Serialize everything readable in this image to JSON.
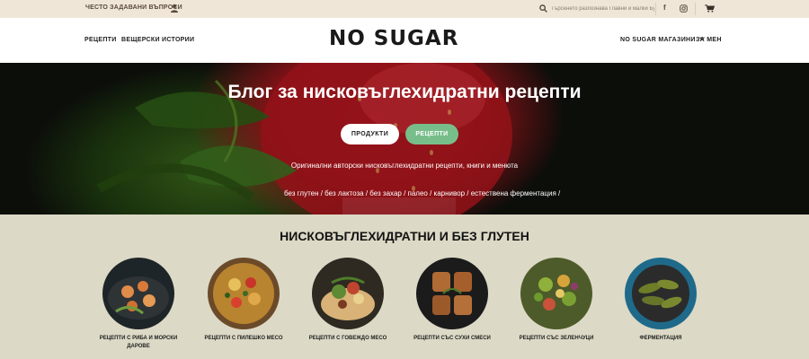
{
  "topbar": {
    "faq": "ЧЕСТО ЗАДАВАНИ ВЪПРОСИ",
    "user_icon": "user-icon",
    "search_placeholder": "Търсенето разпознава Главни и малки Букви",
    "social": [
      "facebook-icon",
      "instagram-icon"
    ],
    "cart_icon": "cart-icon"
  },
  "header": {
    "nav_left": [
      "РЕЦЕПТИ",
      "ВЕЩЕРСКИ ИСТОРИИ"
    ],
    "logo": "NO SUGAR",
    "nav_right": [
      "NO SUGAR МАГАЗИНИ",
      "ЗА МЕН"
    ]
  },
  "hero": {
    "title": "Блог за нисковъглехидратни рецепти",
    "buttons": [
      "ПРОДУКТИ",
      "РЕЦЕПТИ"
    ],
    "subtitle": "Оригинални авторски нисковъглехидратни рецепти, книги и менюта",
    "tags": "без глутен / без лактоза / без захар / палео / карнивор / естествена ферментация /",
    "colors": {
      "recipes_button": "#78be8a",
      "berry": "#c7262e",
      "leaf": "#3d6a1c"
    }
  },
  "section": {
    "title": "НИСКОВЪГЛЕХИДРАТНИ И БЕЗ ГЛУТЕН",
    "categories": [
      {
        "label": "РЕЦЕПТИ С РИБА И МОРСКИ ДАРОВЕ",
        "image": "seafood-photo"
      },
      {
        "label": "РЕЦЕПТИ С ПИЛЕШКО МЕСО",
        "image": "chicken-photo"
      },
      {
        "label": "РЕЦЕПТИ С ГОВЕЖДО МЕСО",
        "image": "beef-photo"
      },
      {
        "label": "РЕЦЕПТИ СЪС СУХИ СМЕСИ",
        "image": "dry-mix-photo"
      },
      {
        "label": "РЕЦЕПТИ СЪС ЗЕЛЕНЧУЦИ",
        "image": "vegetables-photo"
      },
      {
        "label": "ФЕРМЕНТАЦИЯ",
        "image": "fermentation-photo"
      }
    ]
  }
}
